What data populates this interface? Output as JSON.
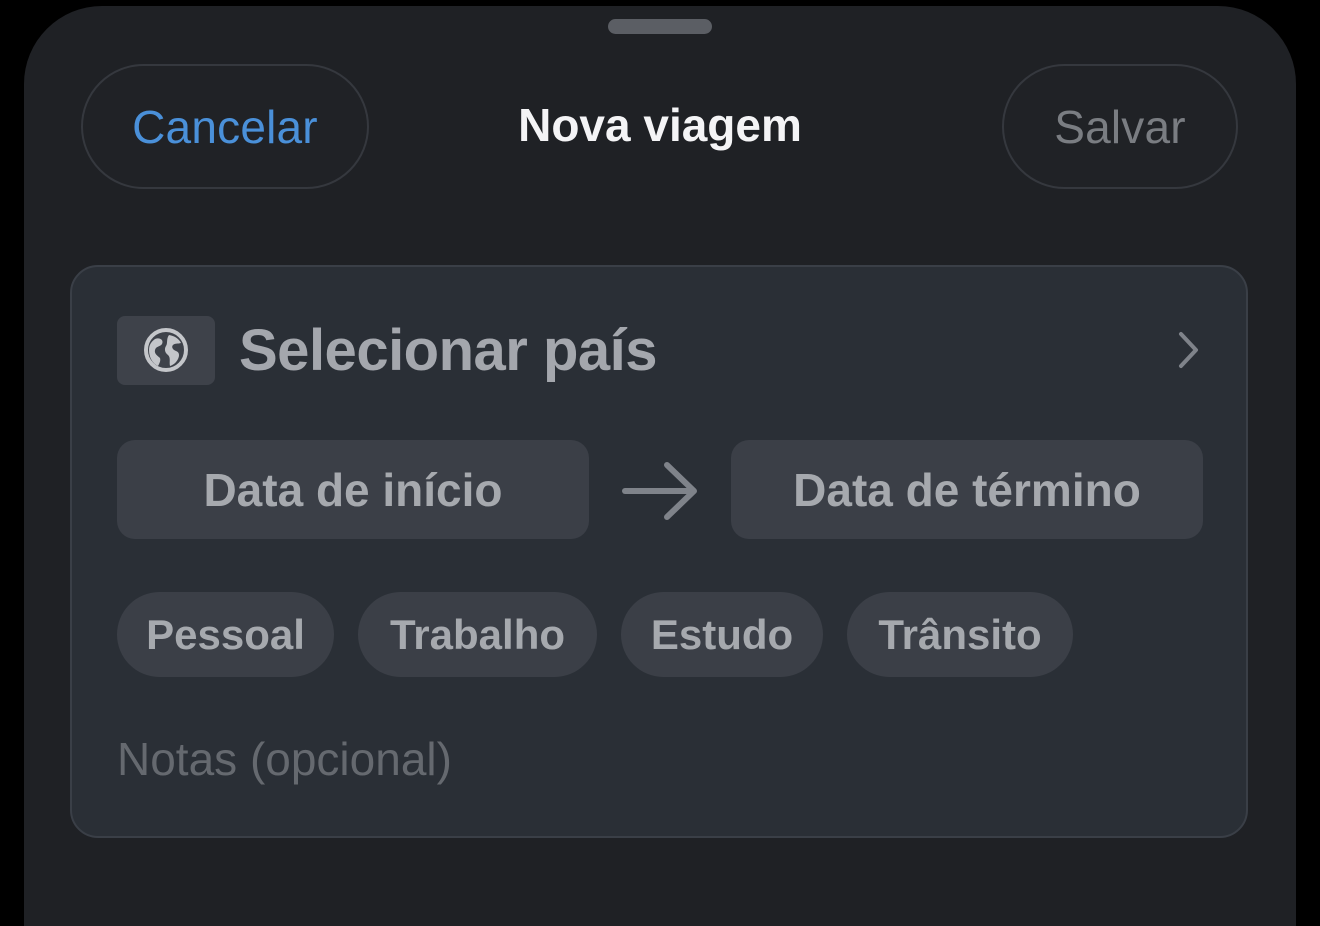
{
  "header": {
    "cancel_label": "Cancelar",
    "title": "Nova viagem",
    "save_label": "Salvar"
  },
  "form": {
    "country": {
      "icon": "globe-icon",
      "label": "Selecionar país",
      "trailing_icon": "chevron-right-icon"
    },
    "dates": {
      "start_label": "Data de início",
      "separator_icon": "arrow-right-icon",
      "end_label": "Data de término"
    },
    "tags": [
      {
        "label": "Pessoal"
      },
      {
        "label": "Trabalho"
      },
      {
        "label": "Estudo"
      },
      {
        "label": "Trânsito"
      }
    ],
    "notes_placeholder": "Notas (opcional)"
  },
  "colors": {
    "accent": "#4a90d9",
    "sheet_background": "#1f2125",
    "card_background": "#2a2f36",
    "control_background": "#3b3f47"
  }
}
